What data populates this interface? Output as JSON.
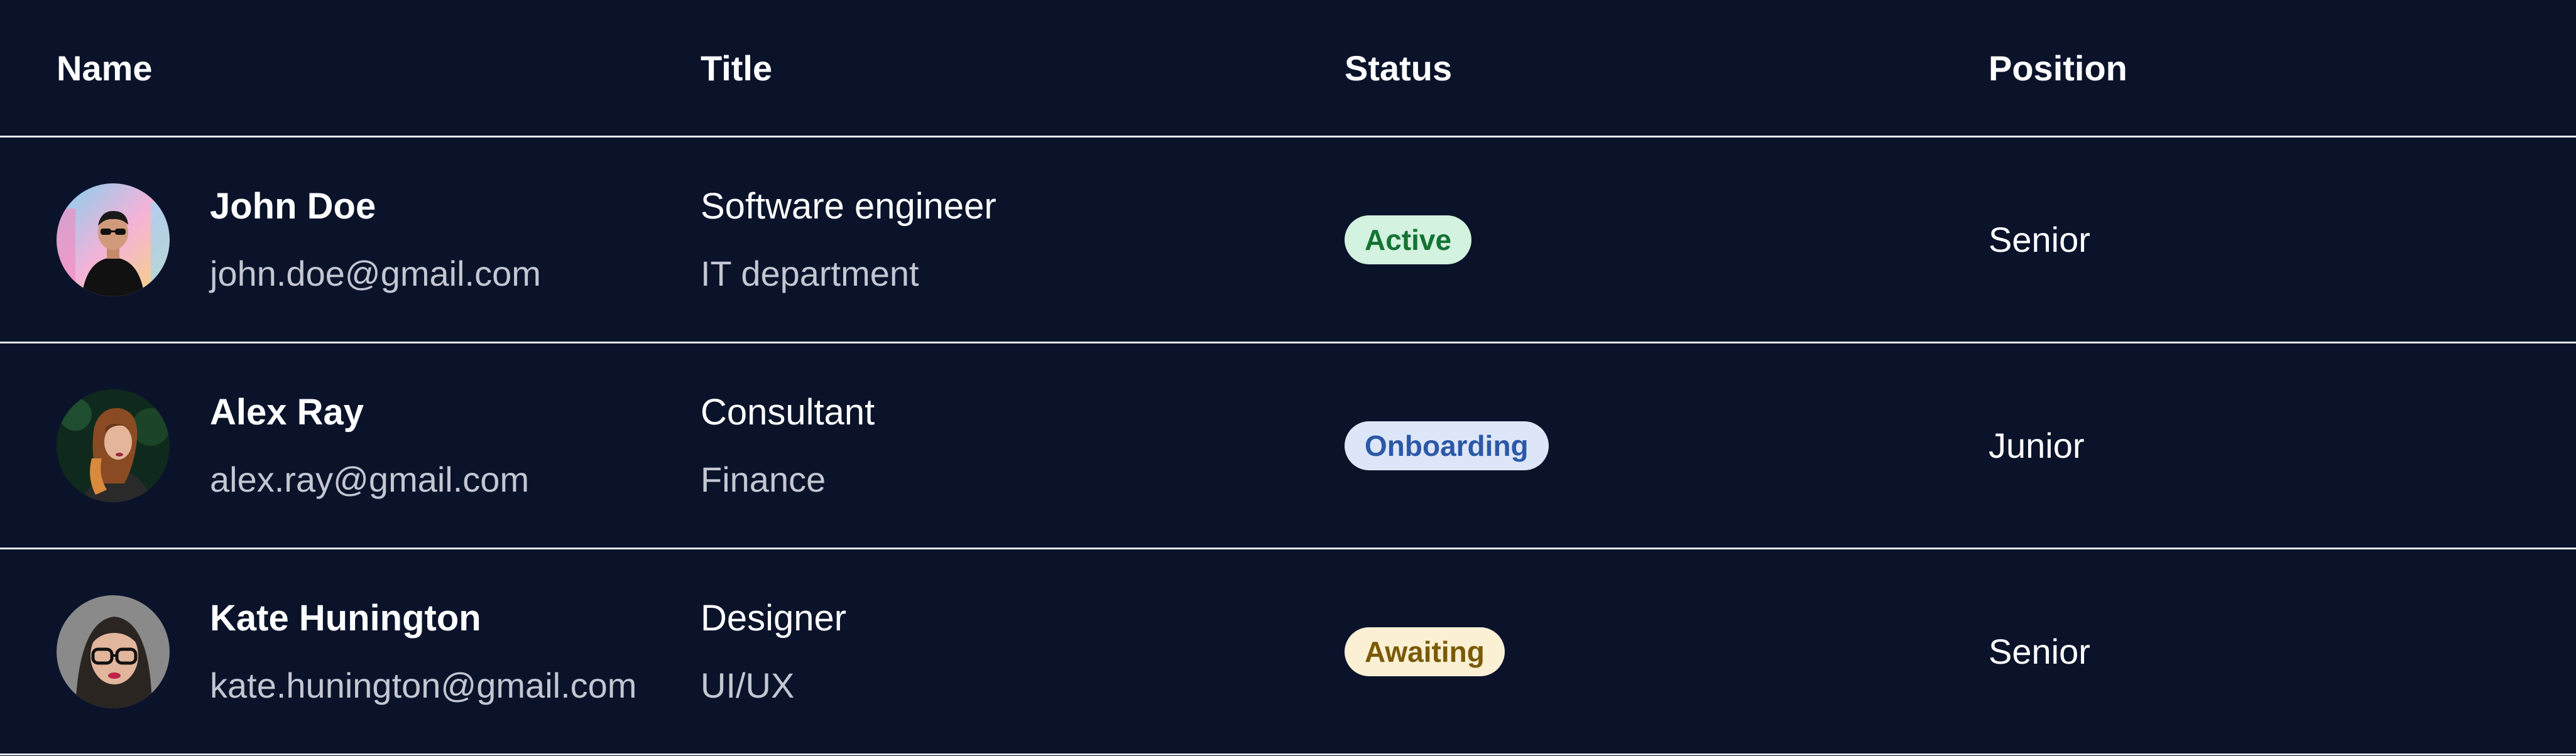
{
  "table": {
    "headers": {
      "name": "Name",
      "title": "Title",
      "status": "Status",
      "position": "Position"
    },
    "rows": [
      {
        "name": "John Doe",
        "email": "john.doe@gmail.com",
        "job_title": "Software engineer",
        "department": "IT department",
        "status": "Active",
        "position": "Senior",
        "avatar_icon": "avatar-man-sunglasses"
      },
      {
        "name": "Alex Ray",
        "email": "alex.ray@gmail.com",
        "job_title": "Consultant",
        "department": "Finance",
        "status": "Onboarding",
        "position": "Junior",
        "avatar_icon": "avatar-woman-auburn-hair"
      },
      {
        "name": "Kate Hunington",
        "email": "kate.hunington@gmail.com",
        "job_title": "Designer",
        "department": "UI/UX",
        "status": "Awaiting",
        "position": "Senior",
        "avatar_icon": "avatar-woman-glasses"
      }
    ]
  },
  "colors": {
    "background": "#0b132b",
    "divider": "#e6e8ee",
    "status_active_bg": "#d3f2df",
    "status_active_text": "#137333",
    "status_onboarding_bg": "#dde6f8",
    "status_onboarding_text": "#2c58a6",
    "status_awaiting_bg": "#fbf0d4",
    "status_awaiting_text": "#7a5a05"
  }
}
